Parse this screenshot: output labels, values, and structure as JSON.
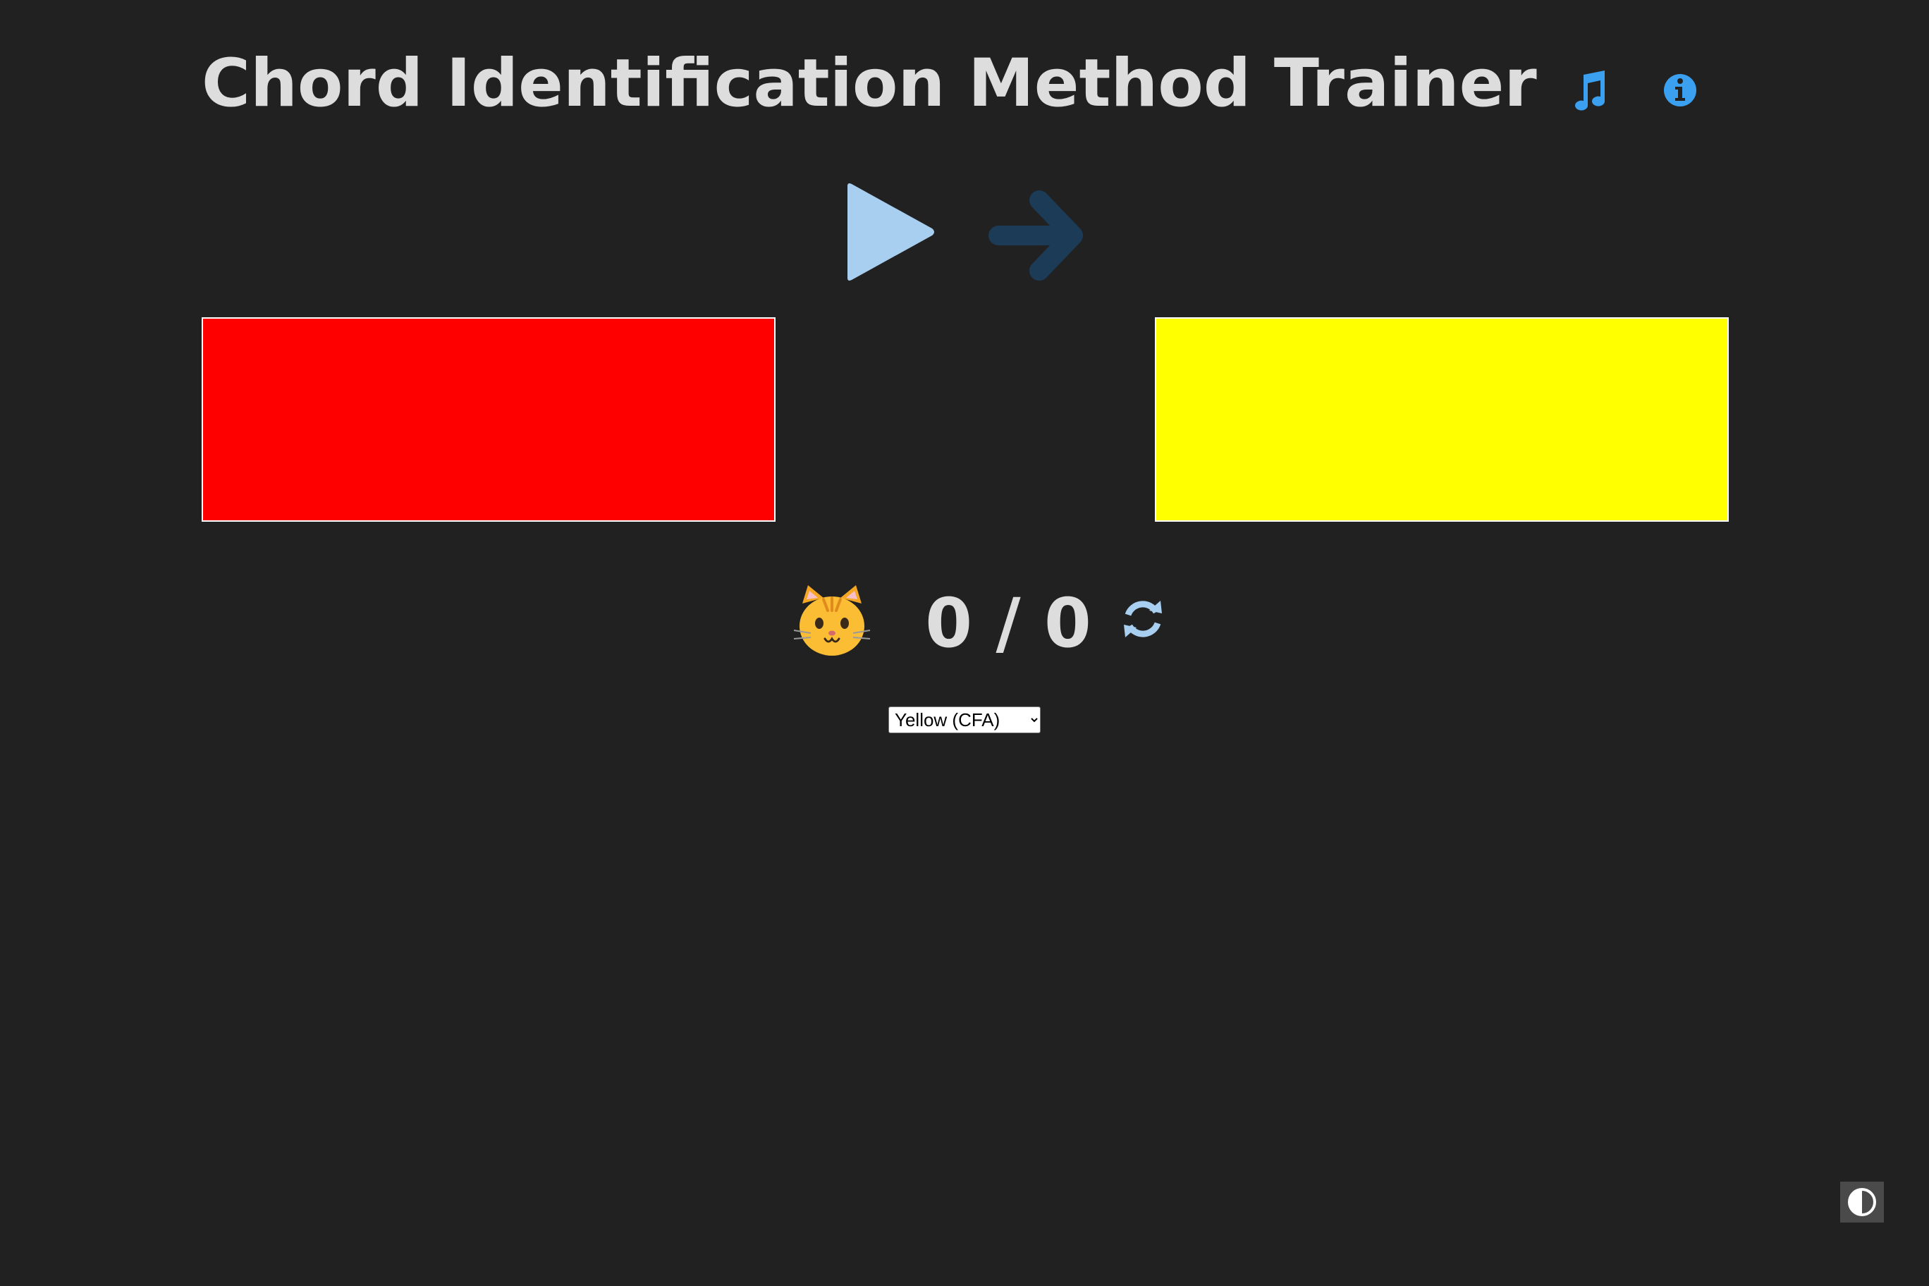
{
  "header": {
    "title": "Chord Identification Method Trainer",
    "music_icon": "music-note-icon",
    "info_icon": "info-circle-icon"
  },
  "controls": {
    "play_icon": "play-icon",
    "next_icon": "arrow-right-icon"
  },
  "chord_boxes": [
    {
      "color_name": "red",
      "color": "#ff0000"
    },
    {
      "color_name": "yellow",
      "color": "#ffff00"
    }
  ],
  "score": {
    "avatar": "😺",
    "text": "0 / 0",
    "reset_icon": "refresh-icon"
  },
  "color_select": {
    "selected": "Yellow (CFA)"
  },
  "theme_toggle_icon": "contrast-icon",
  "colors": {
    "background": "#212121",
    "title": "#dddddd",
    "accent_blue": "#3aa0ef",
    "light_blue": "#a8cff0",
    "dark_blue": "#1c3b57"
  }
}
